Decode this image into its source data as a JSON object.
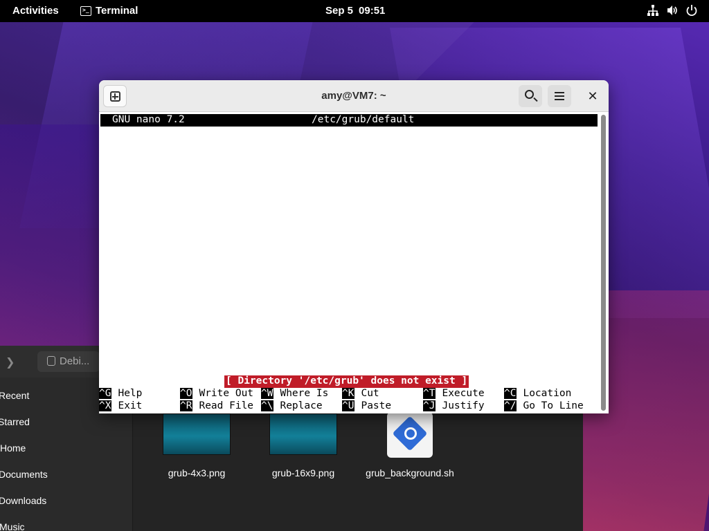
{
  "topbar": {
    "activities": "Activities",
    "app_name": "Terminal",
    "app_icon_glyph": ">_",
    "date": "Sep 5",
    "time": "09:51",
    "status_icons": [
      "network-icon",
      "volume-icon",
      "power-icon"
    ]
  },
  "terminal": {
    "title": "amy@VM7: ~",
    "nano": {
      "version": "GNU nano 7.2",
      "filename": "/etc/grub/default",
      "message": "[ Directory '/etc/grub' does not exist ]",
      "shortcuts_row1": [
        {
          "key": "^G",
          "label": "Help"
        },
        {
          "key": "^O",
          "label": "Write Out"
        },
        {
          "key": "^W",
          "label": "Where Is"
        },
        {
          "key": "^K",
          "label": "Cut"
        },
        {
          "key": "^T",
          "label": "Execute"
        },
        {
          "key": "^C",
          "label": "Location"
        }
      ],
      "shortcuts_row2": [
        {
          "key": "^X",
          "label": "Exit"
        },
        {
          "key": "^R",
          "label": "Read File"
        },
        {
          "key": "^\\",
          "label": "Replace"
        },
        {
          "key": "^U",
          "label": "Paste"
        },
        {
          "key": "^J",
          "label": "Justify"
        },
        {
          "key": "^/",
          "label": "Go To Line"
        }
      ]
    }
  },
  "files": {
    "path_label": "Debi...",
    "sidebar": [
      "Recent",
      "Starred",
      "Home",
      "Documents",
      "Downloads",
      "Music"
    ],
    "items": [
      {
        "name": "grub-4x3.png",
        "kind": "image"
      },
      {
        "name": "grub-16x9.png",
        "kind": "image"
      },
      {
        "name": "grub_background.sh",
        "kind": "script"
      }
    ]
  },
  "colors": {
    "nano_message_bg": "#c01c28",
    "topbar_bg": "#000000",
    "header_bg": "#ebebeb"
  }
}
